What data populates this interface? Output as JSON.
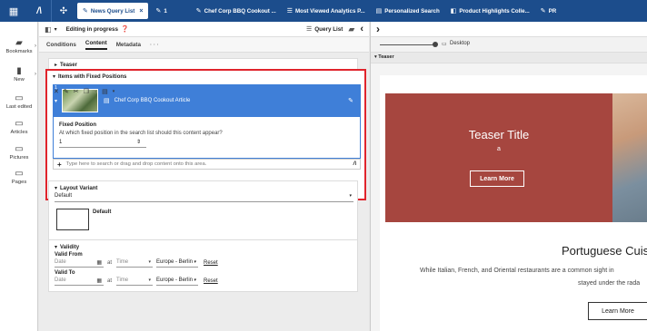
{
  "topbar": {
    "tabs": [
      {
        "label": "News Query List",
        "icon": "✎"
      },
      {
        "label": "1",
        "icon": "✎"
      },
      {
        "label": "Chef Corp BBQ Cookout ...",
        "icon": "✎"
      },
      {
        "label": "Most Viewed Analytics P...",
        "icon": "☰"
      },
      {
        "label": "Personalized Search",
        "icon": "▤"
      },
      {
        "label": "Product Highlights Colle...",
        "icon": "◧"
      },
      {
        "label": "PR",
        "icon": "✎"
      }
    ]
  },
  "leftnav": {
    "items": [
      {
        "label": "Bookmarks"
      },
      {
        "label": "New"
      },
      {
        "label": "Last edited"
      },
      {
        "label": "Articles"
      },
      {
        "label": "Pictures"
      },
      {
        "label": "Pages"
      }
    ]
  },
  "editor": {
    "status": "Editing in progress",
    "doc_type": "Query List",
    "tabs": [
      "Conditions",
      "Content",
      "Metadata",
      "· · ·"
    ],
    "teaser_label": "Teaser",
    "fixed_positions": {
      "title": "Items with Fixed Positions",
      "item_number": "1",
      "item_title": "Chef Corp BBQ Cookout Article",
      "field_label": "Fixed Position",
      "field_question": "At which fixed position in the search list should this content appear?",
      "field_value": "1",
      "search_placeholder": "Type here to search or drag and drop content onto this area."
    },
    "layout_variant": {
      "title": "Layout Variant",
      "selected": "Default",
      "option_label": "Default"
    },
    "validity": {
      "title": "Validity",
      "valid_from": "Valid From",
      "valid_to": "Valid To",
      "date_placeholder": "Date",
      "at": "at",
      "time_placeholder": "Time",
      "timezone": "Europe - Berlin",
      "reset": "Reset"
    }
  },
  "preview": {
    "device": "Desktop",
    "breadcrumb": "Teaser",
    "teaser_title": "Teaser Title",
    "teaser_sub": "a",
    "teaser_button": "Learn More",
    "article_title": "Portuguese Cuis",
    "article_text_1": "While Italian, French, and Oriental restaurants are a common sight in",
    "article_text_2": "stayed under the rada",
    "article_button": "Learn More"
  }
}
